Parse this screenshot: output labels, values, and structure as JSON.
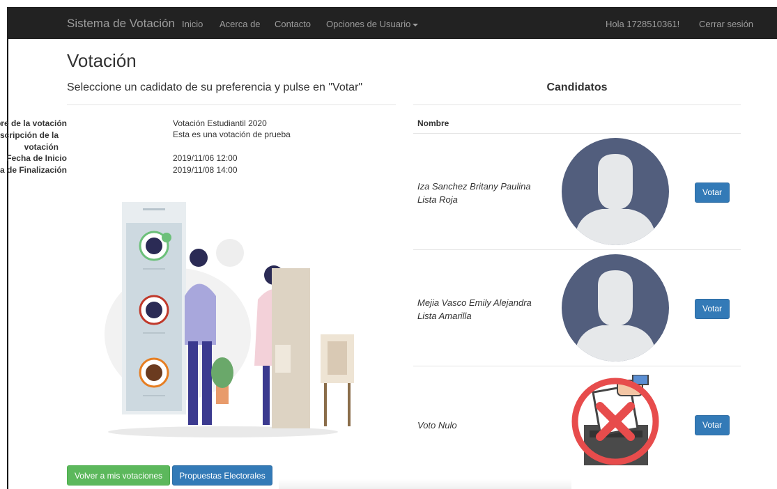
{
  "navbar": {
    "brand": "Sistema de Votación",
    "items": [
      "Inicio",
      "Acerca de",
      "Contacto",
      "Opciones de Usuario"
    ],
    "greeting": "Hola 1728510361!",
    "logout": "Cerrar sesión"
  },
  "page": {
    "title": "Votación",
    "subtitle": "Seleccione un cadidato de su preferencia y pulse en \"Votar\""
  },
  "details": [
    {
      "label": "Nombre de la votación",
      "value": "Votación Estudiantil 2020"
    },
    {
      "label": "Descripción de la votación",
      "value": "Esta es una votación de prueba"
    },
    {
      "label": "Fecha de Inicio",
      "value": "2019/11/06 12:00"
    },
    {
      "label": "Fecha de Finalización",
      "value": "2019/11/08 14:00"
    }
  ],
  "buttons": {
    "back": "Volver a mis votaciones",
    "proposals": "Propuestas Electorales"
  },
  "candidates": {
    "heading": "Candidatos",
    "column": "Nombre",
    "vote_label": "Votar",
    "rows": [
      {
        "name": "Iza Sanchez Britany Paulina",
        "list": "Lista Roja",
        "image": "user-avatar-placeholder"
      },
      {
        "name": "Mejia Vasco Emily Alejandra",
        "list": "Lista Amarilla",
        "image": "user-avatar-placeholder"
      },
      {
        "name": "Voto Nulo",
        "list": "",
        "image": "null-vote-ballot-box"
      }
    ]
  },
  "colors": {
    "navbar": "#222222",
    "primary": "#337ab7",
    "success": "#5cb85c",
    "avatar": "#525e7d"
  }
}
